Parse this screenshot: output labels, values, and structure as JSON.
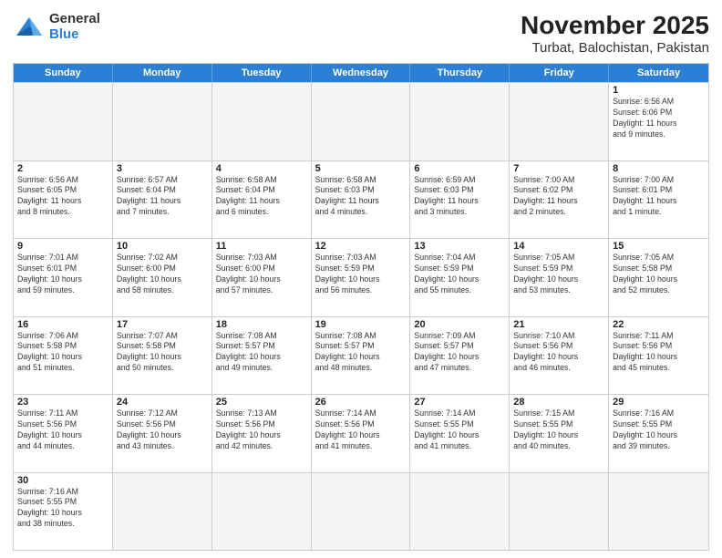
{
  "logo": {
    "line1": "General",
    "line2": "Blue"
  },
  "title": "November 2025",
  "subtitle": "Turbat, Balochistan, Pakistan",
  "weekdays": [
    "Sunday",
    "Monday",
    "Tuesday",
    "Wednesday",
    "Thursday",
    "Friday",
    "Saturday"
  ],
  "rows": [
    [
      {
        "day": "",
        "info": "",
        "empty": true
      },
      {
        "day": "",
        "info": "",
        "empty": true
      },
      {
        "day": "",
        "info": "",
        "empty": true
      },
      {
        "day": "",
        "info": "",
        "empty": true
      },
      {
        "day": "",
        "info": "",
        "empty": true
      },
      {
        "day": "",
        "info": "",
        "empty": true
      },
      {
        "day": "1",
        "info": "Sunrise: 6:56 AM\nSunset: 6:06 PM\nDaylight: 11 hours\nand 9 minutes."
      }
    ],
    [
      {
        "day": "2",
        "info": "Sunrise: 6:56 AM\nSunset: 6:05 PM\nDaylight: 11 hours\nand 8 minutes."
      },
      {
        "day": "3",
        "info": "Sunrise: 6:57 AM\nSunset: 6:04 PM\nDaylight: 11 hours\nand 7 minutes."
      },
      {
        "day": "4",
        "info": "Sunrise: 6:58 AM\nSunset: 6:04 PM\nDaylight: 11 hours\nand 6 minutes."
      },
      {
        "day": "5",
        "info": "Sunrise: 6:58 AM\nSunset: 6:03 PM\nDaylight: 11 hours\nand 4 minutes."
      },
      {
        "day": "6",
        "info": "Sunrise: 6:59 AM\nSunset: 6:03 PM\nDaylight: 11 hours\nand 3 minutes."
      },
      {
        "day": "7",
        "info": "Sunrise: 7:00 AM\nSunset: 6:02 PM\nDaylight: 11 hours\nand 2 minutes."
      },
      {
        "day": "8",
        "info": "Sunrise: 7:00 AM\nSunset: 6:01 PM\nDaylight: 11 hours\nand 1 minute."
      }
    ],
    [
      {
        "day": "9",
        "info": "Sunrise: 7:01 AM\nSunset: 6:01 PM\nDaylight: 10 hours\nand 59 minutes."
      },
      {
        "day": "10",
        "info": "Sunrise: 7:02 AM\nSunset: 6:00 PM\nDaylight: 10 hours\nand 58 minutes."
      },
      {
        "day": "11",
        "info": "Sunrise: 7:03 AM\nSunset: 6:00 PM\nDaylight: 10 hours\nand 57 minutes."
      },
      {
        "day": "12",
        "info": "Sunrise: 7:03 AM\nSunset: 5:59 PM\nDaylight: 10 hours\nand 56 minutes."
      },
      {
        "day": "13",
        "info": "Sunrise: 7:04 AM\nSunset: 5:59 PM\nDaylight: 10 hours\nand 55 minutes."
      },
      {
        "day": "14",
        "info": "Sunrise: 7:05 AM\nSunset: 5:59 PM\nDaylight: 10 hours\nand 53 minutes."
      },
      {
        "day": "15",
        "info": "Sunrise: 7:05 AM\nSunset: 5:58 PM\nDaylight: 10 hours\nand 52 minutes."
      }
    ],
    [
      {
        "day": "16",
        "info": "Sunrise: 7:06 AM\nSunset: 5:58 PM\nDaylight: 10 hours\nand 51 minutes."
      },
      {
        "day": "17",
        "info": "Sunrise: 7:07 AM\nSunset: 5:58 PM\nDaylight: 10 hours\nand 50 minutes."
      },
      {
        "day": "18",
        "info": "Sunrise: 7:08 AM\nSunset: 5:57 PM\nDaylight: 10 hours\nand 49 minutes."
      },
      {
        "day": "19",
        "info": "Sunrise: 7:08 AM\nSunset: 5:57 PM\nDaylight: 10 hours\nand 48 minutes."
      },
      {
        "day": "20",
        "info": "Sunrise: 7:09 AM\nSunset: 5:57 PM\nDaylight: 10 hours\nand 47 minutes."
      },
      {
        "day": "21",
        "info": "Sunrise: 7:10 AM\nSunset: 5:56 PM\nDaylight: 10 hours\nand 46 minutes."
      },
      {
        "day": "22",
        "info": "Sunrise: 7:11 AM\nSunset: 5:56 PM\nDaylight: 10 hours\nand 45 minutes."
      }
    ],
    [
      {
        "day": "23",
        "info": "Sunrise: 7:11 AM\nSunset: 5:56 PM\nDaylight: 10 hours\nand 44 minutes."
      },
      {
        "day": "24",
        "info": "Sunrise: 7:12 AM\nSunset: 5:56 PM\nDaylight: 10 hours\nand 43 minutes."
      },
      {
        "day": "25",
        "info": "Sunrise: 7:13 AM\nSunset: 5:56 PM\nDaylight: 10 hours\nand 42 minutes."
      },
      {
        "day": "26",
        "info": "Sunrise: 7:14 AM\nSunset: 5:56 PM\nDaylight: 10 hours\nand 41 minutes."
      },
      {
        "day": "27",
        "info": "Sunrise: 7:14 AM\nSunset: 5:55 PM\nDaylight: 10 hours\nand 41 minutes."
      },
      {
        "day": "28",
        "info": "Sunrise: 7:15 AM\nSunset: 5:55 PM\nDaylight: 10 hours\nand 40 minutes."
      },
      {
        "day": "29",
        "info": "Sunrise: 7:16 AM\nSunset: 5:55 PM\nDaylight: 10 hours\nand 39 minutes."
      }
    ],
    [
      {
        "day": "30",
        "info": "Sunrise: 7:16 AM\nSunset: 5:55 PM\nDaylight: 10 hours\nand 38 minutes."
      },
      {
        "day": "",
        "info": "",
        "empty": true
      },
      {
        "day": "",
        "info": "",
        "empty": true
      },
      {
        "day": "",
        "info": "",
        "empty": true
      },
      {
        "day": "",
        "info": "",
        "empty": true
      },
      {
        "day": "",
        "info": "",
        "empty": true
      },
      {
        "day": "",
        "info": "",
        "empty": true
      }
    ]
  ]
}
